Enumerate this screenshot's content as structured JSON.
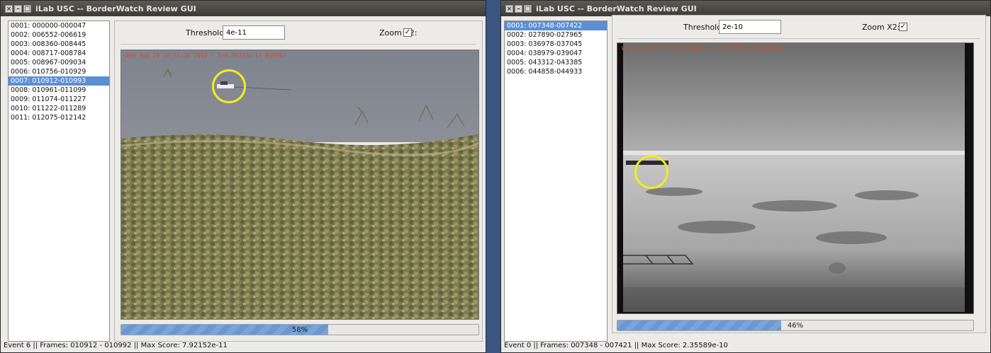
{
  "windows": [
    {
      "title": "iLab USC -- BorderWatch Review GUI",
      "events": [
        "0001: 000000-000047",
        "0002: 006552-006619",
        "0003: 008360-008445",
        "0004: 008717-008784",
        "0005: 008967-009034",
        "0006: 010756-010929",
        "0007: 010912-010993",
        "0008: 010961-011099",
        "0009: 011074-011227",
        "0010: 011222-011289",
        "0011: 012075-012142"
      ],
      "selected_index": 6,
      "threshold_label": "Threshold:",
      "threshold_value": "4e-11",
      "zoom_label": "Zoom X2:",
      "zoom_checked": "✓",
      "osd_text": "Wed Aug 28 20:21:30 2013 - 1=4.36313e-11 010967",
      "progress": 0.58,
      "progress_text": "58%",
      "status": "Event 6 || Frames: 010912 - 010992 || Max Score: 7.92152e-11"
    },
    {
      "title": "iLab USC -- BorderWatch Review GUI",
      "events": [
        "0001: 007348-007422",
        "0002: 027890-027965",
        "0003: 036978-037045",
        "0004: 038979-039047",
        "0005: 043312-043385",
        "0006: 044858-044933"
      ],
      "selected_index": 0,
      "threshold_label": "Threshold:",
      "threshold_value": "2e-10",
      "zoom_label": "Zoom X2:",
      "zoom_checked": "✓",
      "osd_text": "Wed Aug 28 05:56:19 2013 - 1=8.35574e-10 007369",
      "progress": 0.46,
      "progress_text": "46%",
      "status": "Event 0 || Frames: 007348 - 007421 || Max Score: 2.35589e-10"
    }
  ],
  "colors": {
    "selection": "#5b8fd5",
    "detection_ring": "#f2ec1f",
    "osd_text": "#e04a1e",
    "progress_fill": "#7aa4dc"
  },
  "icons": [
    "window-close-icon",
    "window-minimize-icon",
    "window-maximize-icon",
    "checkbox-checked-icon"
  ]
}
